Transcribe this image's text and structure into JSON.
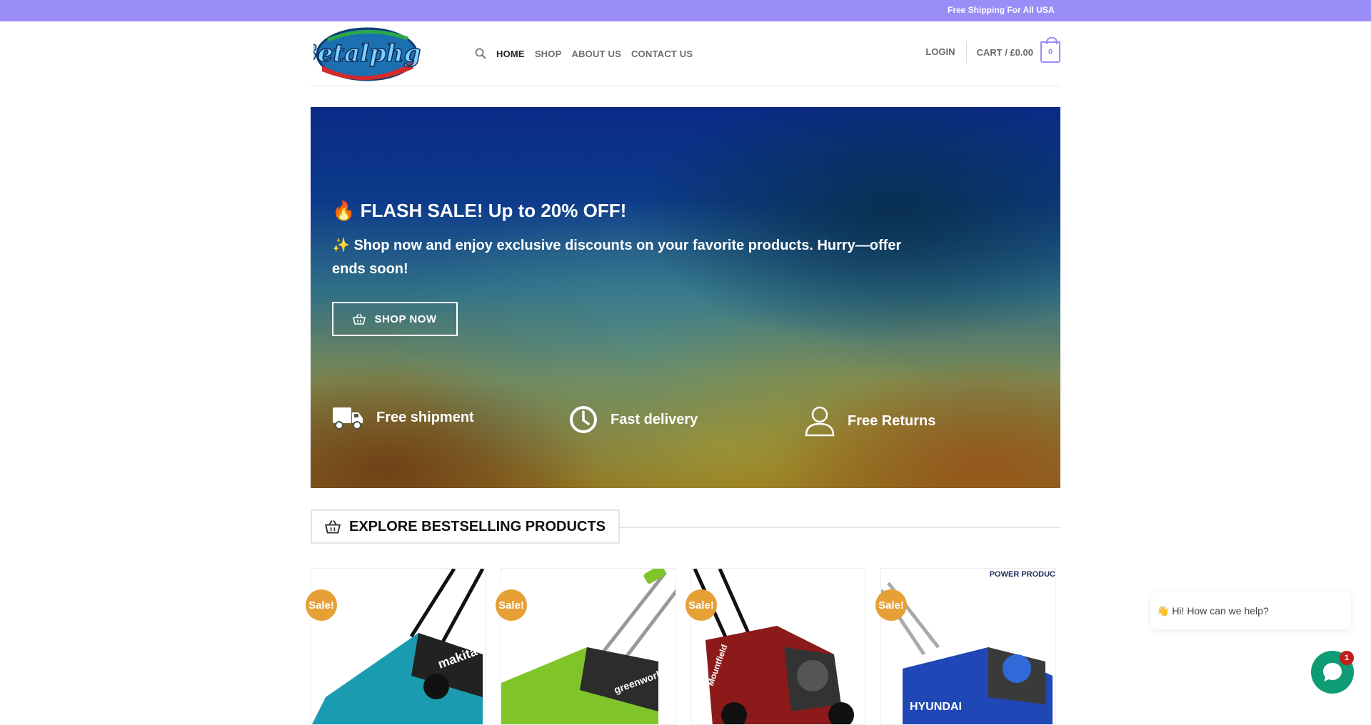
{
  "topbar": {
    "text": "Free Shipping For All USA"
  },
  "header": {
    "logo_text": "Betalphgo",
    "nav": [
      {
        "label": "HOME",
        "active": true
      },
      {
        "label": "SHOP",
        "active": false
      },
      {
        "label": "ABOUT US",
        "active": false
      },
      {
        "label": "CONTACT US",
        "active": false
      }
    ],
    "login_label": "LOGIN",
    "cart_label": "CART / £0.00",
    "cart_count": "0"
  },
  "hero": {
    "title": "🔥 FLASH SALE! Up to 20% OFF!",
    "subtitle": "✨ Shop now and enjoy exclusive discounts on your favorite products. Hurry—offer ends soon!",
    "button_label": "SHOP NOW",
    "features": [
      {
        "icon": "truck-icon",
        "label": "Free shipment"
      },
      {
        "icon": "clock-icon",
        "label": "Fast delivery"
      },
      {
        "icon": "user-icon",
        "label": "Free Returns"
      }
    ]
  },
  "bestsellers": {
    "title": "EXPLORE BESTSELLING PRODUCTS",
    "products": [
      {
        "sale_label": "Sale!",
        "brand": "makita",
        "color": "#1b9bb0"
      },
      {
        "sale_label": "Sale!",
        "brand": "greenworks",
        "color": "#7fc52a"
      },
      {
        "sale_label": "Sale!",
        "brand": "Mountfield",
        "color": "#8c1a1a"
      },
      {
        "sale_label": "Sale!",
        "brand": "HYUNDAI",
        "color": "#1f47b5",
        "tag": "POWER PRODUC"
      }
    ]
  },
  "chat": {
    "greeting": "👋 Hi! How can we help?",
    "badge": "1"
  },
  "colors": {
    "accent": "#9b8df7",
    "sale": "#e6a035",
    "chat": "#0f9b75"
  }
}
